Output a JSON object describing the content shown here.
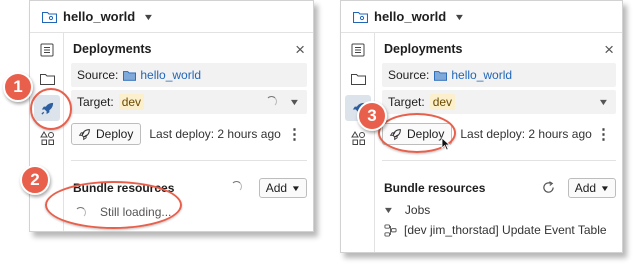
{
  "colors": {
    "accent": "#e8604c",
    "link": "#2266b8",
    "target_pill": "#fbefcc"
  },
  "left": {
    "bundle_name": "hello_world",
    "deployments_title": "Deployments",
    "source_label": "Source:",
    "source_value": "hello_world",
    "target_label": "Target:",
    "target_value": "dev",
    "deploy_label": "Deploy",
    "last_deploy": "Last deploy: 2 hours ago",
    "resources_title": "Bundle resources",
    "add_label": "Add",
    "loading_text": "Still loading..."
  },
  "right": {
    "bundle_name": "hello_world",
    "deployments_title": "Deployments",
    "source_label": "Source:",
    "source_value": "hello_world",
    "target_label": "Target:",
    "target_value": "dev",
    "deploy_label": "Deploy",
    "last_deploy": "Last deploy: 2 hours ago",
    "resources_title": "Bundle resources",
    "add_label": "Add",
    "jobs_label": "Jobs",
    "job_item": "[dev jim_thorstad] Update Event Table"
  },
  "callouts": {
    "one": "1",
    "two": "2",
    "three": "3"
  },
  "icons": {
    "close": "×",
    "kebab": "⋮",
    "chevron": "⌄"
  }
}
